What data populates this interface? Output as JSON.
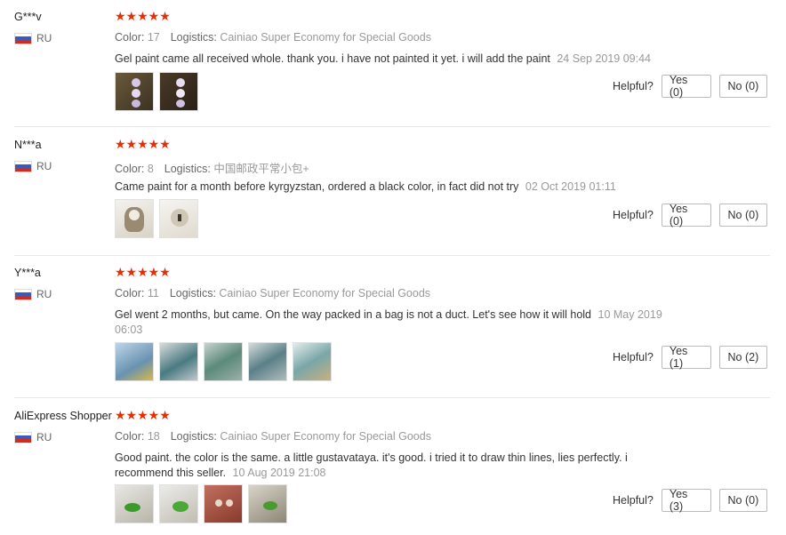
{
  "helpful_label": "Helpful?",
  "color_label": "Color:",
  "logistics_label": "Logistics:",
  "reviews": [
    {
      "user": "G***v",
      "country": "RU",
      "stars": "★★★★★",
      "color": "17",
      "logistics": "Cainiao Super Economy for Special Goods",
      "text": "Gel paint came all received whole. thank you. i have not painted it yet. i will add the paint",
      "date": "24 Sep 2019 09:44",
      "yes": "Yes (0)",
      "no": "No (0)"
    },
    {
      "user": "N***a",
      "country": "RU",
      "stars": "★★★★★",
      "color": "8",
      "logistics": "中国邮政平常小包+",
      "text": "Came paint for a month before kyrgyzstan, ordered a black color, in fact did not try",
      "date": "02 Oct 2019 01:11",
      "yes": "Yes (0)",
      "no": "No (0)"
    },
    {
      "user": "Y***a",
      "country": "RU",
      "stars": "★★★★★",
      "color": "11",
      "logistics": "Cainiao Super Economy for Special Goods",
      "text": "Gel went 2 months, but came. On the way packed in a bag is not a duct. Let's see how it will hold",
      "date": "10 May 2019 06:03",
      "yes": "Yes (1)",
      "no": "No (2)"
    },
    {
      "user": "AliExpress Shopper",
      "country": "RU",
      "stars": "★★★★★",
      "color": "18",
      "logistics": "Cainiao Super Economy for Special Goods",
      "text": "Good paint. the color is the same. a little gustavataya. it's good. i tried it to draw thin lines, lies perfectly. i recommend this seller.",
      "date": "10 Aug 2019 21:08",
      "yes": "Yes (3)",
      "no": "No (0)"
    }
  ]
}
